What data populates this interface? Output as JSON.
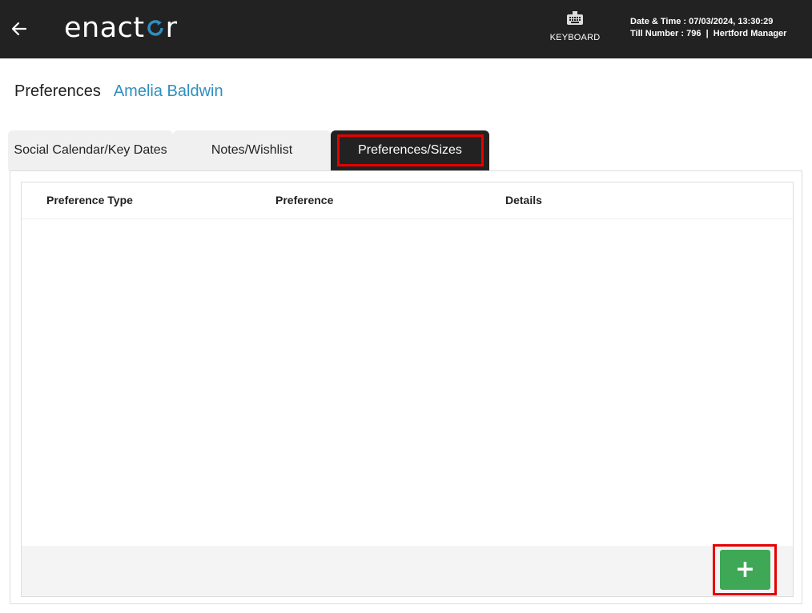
{
  "header": {
    "logo_text_left": "enact",
    "logo_text_right": "r",
    "keyboard_label": "KEYBOARD",
    "datetime_label": "Date & Time",
    "datetime_value": "07/03/2024, 13:30:29",
    "till_label": "Till Number",
    "till_value": "796",
    "user_label": "Hertford Manager",
    "icons": [
      "back-arrow-icon",
      "keyboard-icon"
    ],
    "colors": {
      "bar": "#222222",
      "logo_accent": "#2e8fbf"
    }
  },
  "page": {
    "title": "Preferences",
    "customer_name": "Amelia Baldwin",
    "customer_name_color": "#2e8fbf"
  },
  "tabs": [
    {
      "label": "Social Calendar/Key Dates",
      "active": false
    },
    {
      "label": "Notes/Wishlist",
      "active": false
    },
    {
      "label": "Preferences/Sizes",
      "active": true
    }
  ],
  "table": {
    "columns": [
      "Preference Type",
      "Preference",
      "Details"
    ],
    "rows": []
  },
  "actions": {
    "add_label": "+",
    "add_color": "#3ea856",
    "highlight_color": "#e60000"
  }
}
